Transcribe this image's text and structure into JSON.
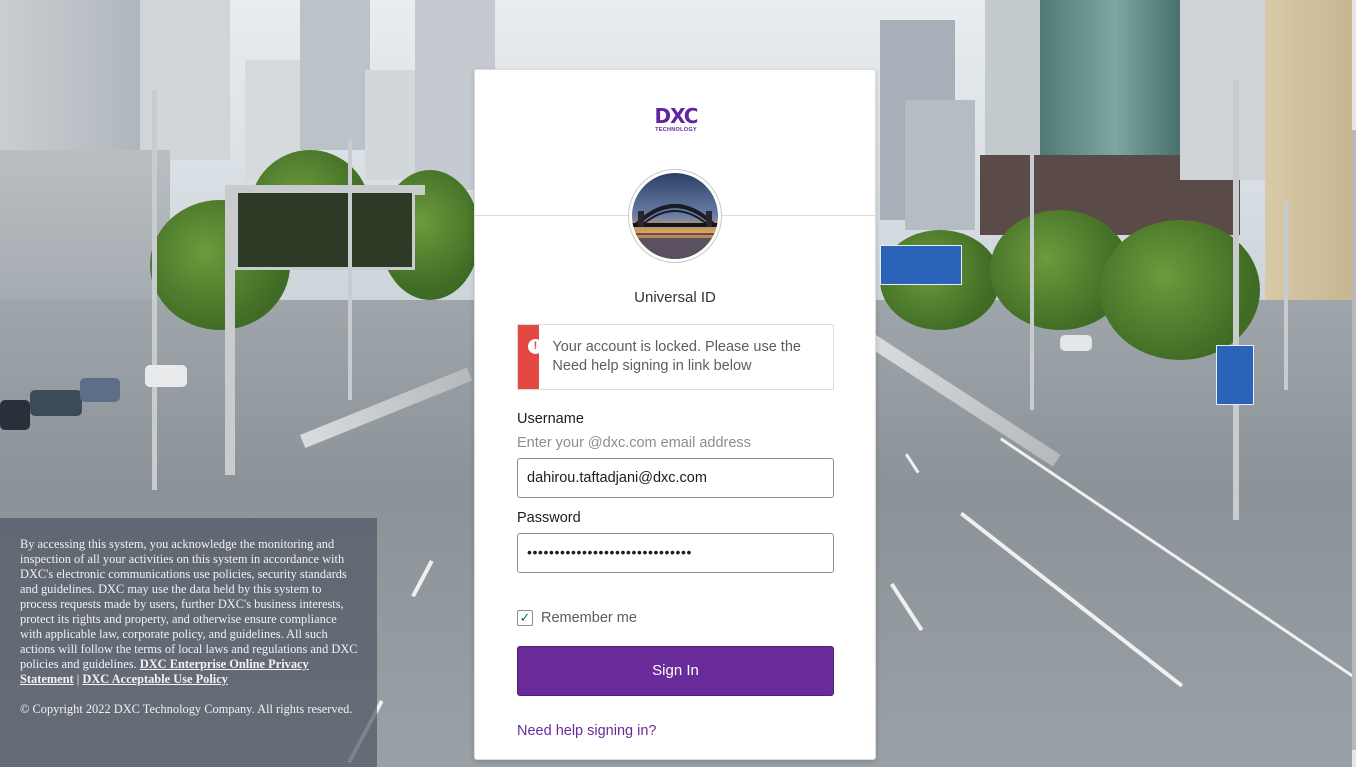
{
  "brand": {
    "logo_text": "DXC",
    "logo_subtext": "TECHNOLOGY",
    "accent_color": "#6a2b9a"
  },
  "card": {
    "heading": "Universal ID",
    "alert": {
      "icon": "error-exclamation-icon",
      "color": "#e34843",
      "message": "Your account is locked. Please use the Need help signing in link below"
    },
    "username": {
      "label": "Username",
      "hint": "Enter your @dxc.com email address",
      "value": "dahirou.taftadjani@dxc.com"
    },
    "password": {
      "label": "Password",
      "masked_value": "••••••••••••••••••••••••••••••"
    },
    "remember_me": {
      "label": "Remember me",
      "checked": true
    },
    "sign_in_label": "Sign In",
    "help_link_label": "Need help signing in?"
  },
  "disclaimer": {
    "body": "By accessing this system, you acknowledge the monitoring and inspection of all your activities on this system in accordance with DXC's electronic communications use policies, security standards and guidelines. DXC may use the data held by this system to process requests made by users, further DXC's business interests, protect its rights and property, and otherwise ensure compliance with applicable law, corporate policy, and guidelines. All such actions will follow the terms of local laws and regulations and DXC policies and guidelines.",
    "privacy_link": "DXC Enterprise Online Privacy Statement",
    "separator": "|",
    "policy_link": "DXC Acceptable Use Policy",
    "copyright": "© Copyright 2022 DXC Technology Company. All rights reserved."
  }
}
